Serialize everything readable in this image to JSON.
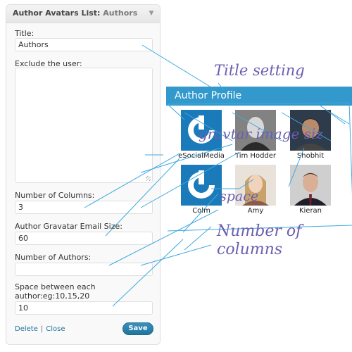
{
  "widget": {
    "title": "Author Avatars List:",
    "subtitle": "Authors",
    "fields": {
      "title_label": "Title:",
      "title_value": "Authors",
      "exclude_label": "Exclude the user:",
      "columns_label": "Number of Columns:",
      "columns_value": "3",
      "size_label": "Author Gravatar Email Size:",
      "size_value": "60",
      "authors_label": "Number of Authors:",
      "authors_value": "",
      "space_label_line1": "Space between each",
      "space_label_line2": "author:eg:10,15,20",
      "space_value": "10"
    },
    "actions": {
      "delete": "Delete",
      "separator": "|",
      "close": "Close",
      "save": "Save"
    }
  },
  "profile": {
    "header": "Author Profile",
    "authors": [
      {
        "name": "eSocialMedia",
        "avatar": "gravatar-logo"
      },
      {
        "name": "Tim Hodder",
        "avatar": "photo"
      },
      {
        "name": "Shobhit",
        "avatar": "photo"
      },
      {
        "name": "Colm",
        "avatar": "gravatar-logo"
      },
      {
        "name": "Amy",
        "avatar": "photo"
      },
      {
        "name": "Kieran",
        "avatar": "photo"
      }
    ]
  },
  "annotations": {
    "title_setting": "Title setting",
    "gravatar_size": "gravtar image siz",
    "space": "space",
    "columns_line1": "Number of",
    "columns_line2": "columns"
  },
  "colors": {
    "header_blue": "#3399cc",
    "save_blue": "#21759b",
    "annotation_purple": "#6a5fb0",
    "annotation_lines": "#3fa9e0"
  }
}
